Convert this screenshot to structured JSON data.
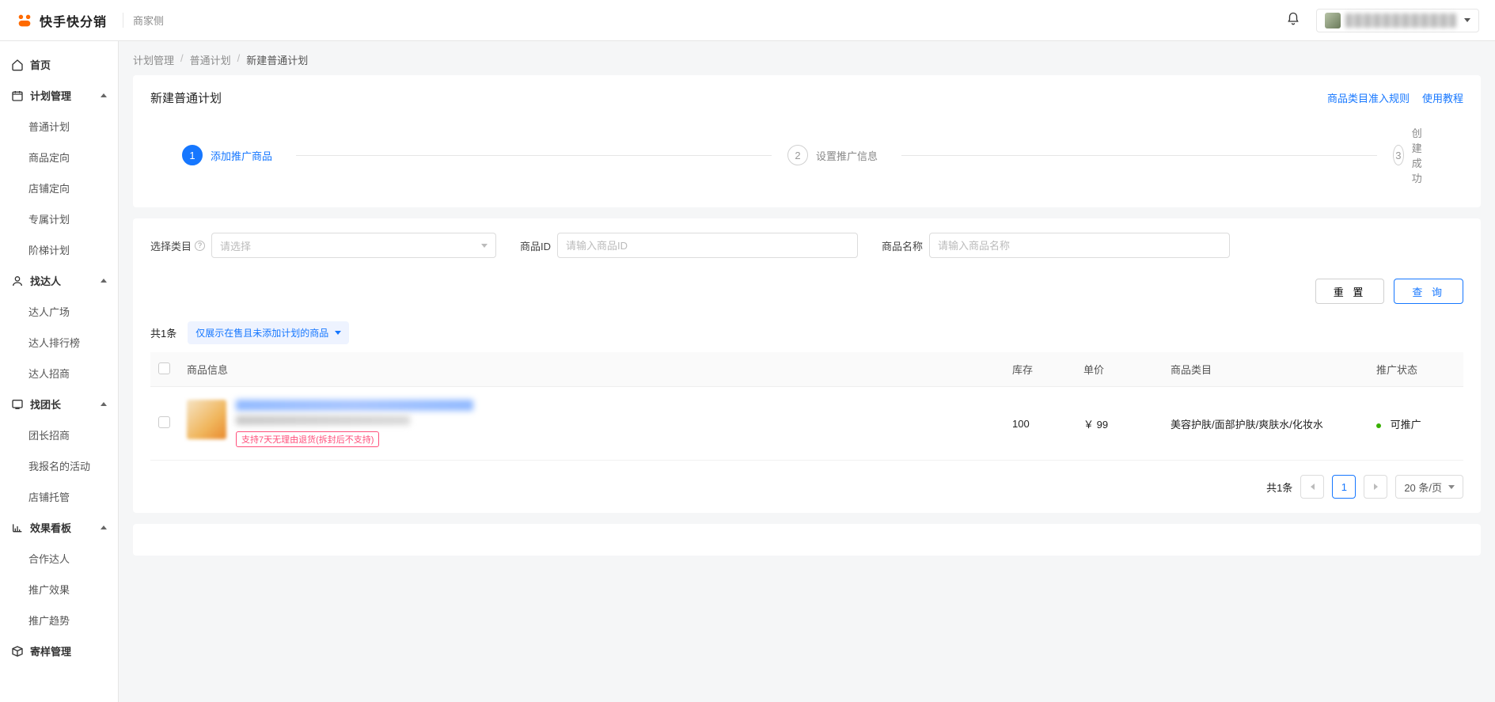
{
  "header": {
    "logo_text": "快手快分销",
    "logo_sub": "商家侧"
  },
  "sidebar": {
    "home": "首页",
    "plan_mgmt": "计划管理",
    "plan_items": [
      "普通计划",
      "商品定向",
      "店铺定向",
      "专属计划",
      "阶梯计划"
    ],
    "find_daren": "找达人",
    "daren_items": [
      "达人广场",
      "达人排行榜",
      "达人招商"
    ],
    "find_tuanzhang": "找团长",
    "tz_items": [
      "团长招商",
      "我报名的活动",
      "店铺托管"
    ],
    "dashboard": "效果看板",
    "dash_items": [
      "合作达人",
      "推广效果",
      "推广趋势"
    ],
    "sample_mgmt": "寄样管理"
  },
  "breadcrumb": [
    "计划管理",
    "普通计划",
    "新建普通计划"
  ],
  "page": {
    "title": "新建普通计划",
    "rule_link": "商品类目准入规则",
    "guide_link": "使用教程"
  },
  "steps": [
    "添加推广商品",
    "设置推广信息",
    "创建成功"
  ],
  "filters": {
    "category_label": "选择类目",
    "category_placeholder": "请选择",
    "id_label": "商品ID",
    "id_placeholder": "请输入商品ID",
    "name_label": "商品名称",
    "name_placeholder": "请输入商品名称",
    "reset_btn": "重 置",
    "search_btn": "查 询"
  },
  "list": {
    "total_text": "共1条",
    "filter_tag": "仅展示在售且未添加计划的商品",
    "columns": [
      "商品信息",
      "库存",
      "单价",
      "商品类目",
      "推广状态"
    ],
    "rows": [
      {
        "refund_tag": "支持7天无理由退货(拆封后不支持)",
        "stock": "100",
        "price": "￥ 99",
        "category": "美容护肤/面部护肤/爽肤水/化妆水",
        "status": "可推广"
      }
    ],
    "page_total": "共1条",
    "page_current": "1",
    "page_size": "20 条/页"
  }
}
